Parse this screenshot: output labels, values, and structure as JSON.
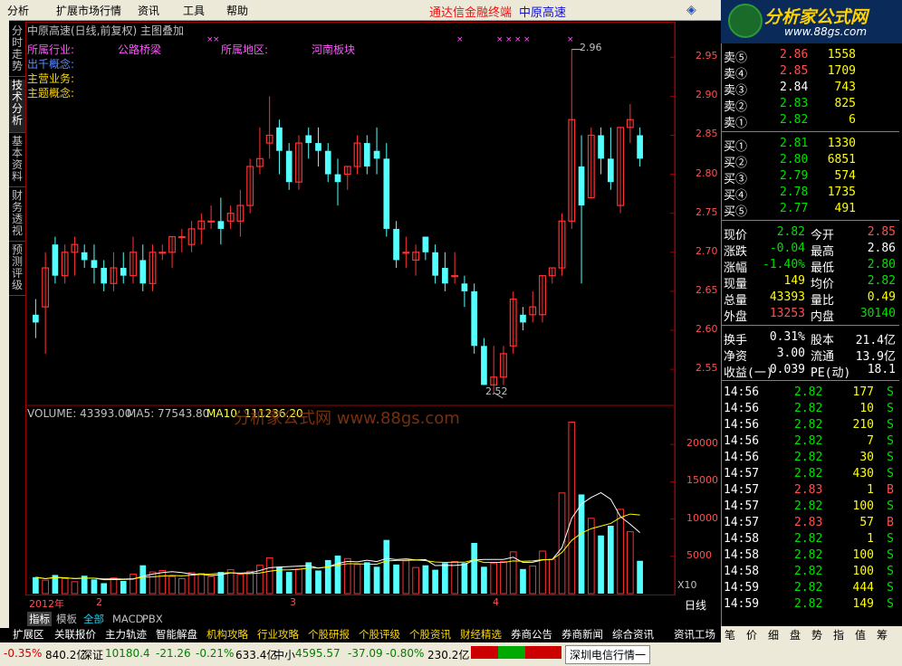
{
  "menu": {
    "items": [
      "分析",
      "扩展市场行情",
      "资讯",
      "工具",
      "帮助"
    ],
    "center_title": "通达信金融终端",
    "stock_name": "中原高速"
  },
  "logo": {
    "brand": "分析家公式网",
    "url": "www.88gs.com"
  },
  "vtabs": [
    "分时走势",
    "技术分析",
    "基本资料",
    "财务透视",
    "预测评级"
  ],
  "chart": {
    "title": "中原高速(日线,前复权) 主图叠加",
    "info": [
      {
        "label": "所属行业:",
        "value": "公路桥梁"
      },
      {
        "label": "所属地区:",
        "value": "河南板块"
      },
      {
        "label": "出千概念:"
      },
      {
        "label": "主营业务:"
      },
      {
        "label": "主题概念:"
      }
    ],
    "high_mark": "2.96",
    "low_mark": "2.52",
    "y_ticks": [
      "2.95",
      "2.90",
      "2.85",
      "2.80",
      "2.75",
      "2.70",
      "2.65",
      "2.60",
      "2.55"
    ],
    "vol_ticks": [
      "20000",
      "15000",
      "10000",
      "5000"
    ],
    "vol_scale": "X10",
    "volume_label": "VOLUME: 43393.00",
    "ma5_label": "MA5: 77543.80",
    "ma10_label": "MA10: 111236.20",
    "watermark": "分析家公式网 www.88gs.com",
    "dates": [
      "2012年",
      "2",
      "3",
      "4"
    ],
    "period": "日线"
  },
  "chart_data": {
    "type": "candlestick",
    "ohlc": [
      [
        2.62,
        2.64,
        2.59,
        2.61
      ],
      [
        2.63,
        2.7,
        2.57,
        2.68
      ],
      [
        2.71,
        2.72,
        2.66,
        2.67
      ],
      [
        2.67,
        2.71,
        2.66,
        2.7
      ],
      [
        2.7,
        2.72,
        2.67,
        2.71
      ],
      [
        2.7,
        2.71,
        2.68,
        2.69
      ],
      [
        2.69,
        2.71,
        2.66,
        2.68
      ],
      [
        2.68,
        2.69,
        2.65,
        2.66
      ],
      [
        2.66,
        2.7,
        2.65,
        2.68
      ],
      [
        2.68,
        2.7,
        2.66,
        2.67
      ],
      [
        2.67,
        2.72,
        2.66,
        2.7
      ],
      [
        2.69,
        2.71,
        2.65,
        2.66
      ],
      [
        2.66,
        2.71,
        2.65,
        2.7
      ],
      [
        2.7,
        2.71,
        2.69,
        2.7
      ],
      [
        2.7,
        2.72,
        2.68,
        2.72
      ],
      [
        2.72,
        2.73,
        2.7,
        2.72
      ],
      [
        2.71,
        2.74,
        2.7,
        2.73
      ],
      [
        2.73,
        2.75,
        2.71,
        2.74
      ],
      [
        2.74,
        2.76,
        2.73,
        2.74
      ],
      [
        2.74,
        2.77,
        2.71,
        2.73
      ],
      [
        2.74,
        2.76,
        2.73,
        2.75
      ],
      [
        2.74,
        2.78,
        2.72,
        2.76
      ],
      [
        2.76,
        2.82,
        2.75,
        2.81
      ],
      [
        2.81,
        2.86,
        2.8,
        2.82
      ],
      [
        2.84,
        2.9,
        2.82,
        2.85
      ],
      [
        2.86,
        2.87,
        2.8,
        2.83
      ],
      [
        2.83,
        2.84,
        2.78,
        2.79
      ],
      [
        2.79,
        2.85,
        2.78,
        2.84
      ],
      [
        2.85,
        2.86,
        2.82,
        2.84
      ],
      [
        2.84,
        2.86,
        2.81,
        2.83
      ],
      [
        2.83,
        2.84,
        2.79,
        2.8
      ],
      [
        2.8,
        2.82,
        2.76,
        2.79
      ],
      [
        2.8,
        2.81,
        2.78,
        2.81
      ],
      [
        2.81,
        2.85,
        2.8,
        2.84
      ],
      [
        2.84,
        2.85,
        2.8,
        2.81
      ],
      [
        2.83,
        2.86,
        2.8,
        2.82
      ],
      [
        2.82,
        2.84,
        2.72,
        2.73
      ],
      [
        2.73,
        2.74,
        2.68,
        2.69
      ],
      [
        2.7,
        2.72,
        2.68,
        2.7
      ],
      [
        2.69,
        2.71,
        2.67,
        2.7
      ],
      [
        2.72,
        2.72,
        2.69,
        2.7
      ],
      [
        2.7,
        2.71,
        2.66,
        2.67
      ],
      [
        2.68,
        2.7,
        2.65,
        2.66
      ],
      [
        2.67,
        2.7,
        2.66,
        2.67
      ],
      [
        2.66,
        2.67,
        2.63,
        2.65
      ],
      [
        2.65,
        2.66,
        2.57,
        2.58
      ],
      [
        2.58,
        2.59,
        2.53,
        2.53
      ],
      [
        2.53,
        2.58,
        2.52,
        2.54
      ],
      [
        2.54,
        2.58,
        2.53,
        2.57
      ],
      [
        2.58,
        2.65,
        2.57,
        2.64
      ],
      [
        2.62,
        2.63,
        2.6,
        2.61
      ],
      [
        2.62,
        2.65,
        2.61,
        2.63
      ],
      [
        2.62,
        2.67,
        2.61,
        2.67
      ],
      [
        2.67,
        2.68,
        2.66,
        2.68
      ],
      [
        2.68,
        2.75,
        2.67,
        2.74
      ],
      [
        2.74,
        2.96,
        2.73,
        2.87
      ],
      [
        2.81,
        2.85,
        2.66,
        2.76
      ],
      [
        2.77,
        2.86,
        2.77,
        2.85
      ],
      [
        2.85,
        2.86,
        2.8,
        2.82
      ],
      [
        2.82,
        2.86,
        2.78,
        2.79
      ],
      [
        2.76,
        2.86,
        2.75,
        2.86
      ],
      [
        2.86,
        2.89,
        2.84,
        2.87
      ],
      [
        2.85,
        2.86,
        2.81,
        2.82
      ]
    ],
    "volume": [
      2200,
      1800,
      2500,
      2000,
      1600,
      2400,
      1900,
      1400,
      2100,
      1700,
      2600,
      3800,
      2900,
      3100,
      2300,
      2000,
      2800,
      2700,
      2300,
      2900,
      3200,
      2600,
      3000,
      3800,
      4800,
      3600,
      2900,
      3300,
      4200,
      3100,
      4500,
      5100,
      4700,
      3900,
      4200,
      3600,
      7200,
      3900,
      4400,
      3500,
      3800,
      3200,
      4100,
      4300,
      4100,
      6800,
      3600,
      4100,
      4300,
      5600,
      3300,
      3700,
      5700,
      4600,
      13500,
      23000,
      13300,
      10100,
      7800,
      9100,
      11300,
      8300,
      4400
    ],
    "ylim": [
      2.52,
      2.97
    ]
  },
  "quote": {
    "sell": [
      [
        "卖⑤",
        "2.86",
        "1558"
      ],
      [
        "卖④",
        "2.85",
        "1709"
      ],
      [
        "卖③",
        "2.84",
        "743"
      ],
      [
        "卖②",
        "2.83",
        "825"
      ],
      [
        "卖①",
        "2.82",
        "6"
      ]
    ],
    "buy": [
      [
        "买①",
        "2.81",
        "1330"
      ],
      [
        "买②",
        "2.80",
        "6851"
      ],
      [
        "买③",
        "2.79",
        "574"
      ],
      [
        "买④",
        "2.78",
        "1735"
      ],
      [
        "买⑤",
        "2.77",
        "491"
      ]
    ],
    "stats": [
      [
        "现价",
        "2.82",
        "今开",
        "2.85"
      ],
      [
        "涨跌",
        "-0.04",
        "最高",
        "2.86"
      ],
      [
        "涨幅",
        "-1.40%",
        "最低",
        "2.80"
      ],
      [
        "现量",
        "149",
        "均价",
        "2.82"
      ],
      [
        "总量",
        "43393",
        "量比",
        "0.49"
      ],
      [
        "外盘",
        "13253",
        "内盘",
        "30140"
      ]
    ],
    "stats2": [
      [
        "换手",
        "0.31%",
        "股本",
        "21.4亿"
      ],
      [
        "净资",
        "3.00",
        "流通",
        "13.9亿"
      ],
      [
        "收益(一)",
        "0.039",
        "PE(动)",
        "18.1"
      ]
    ],
    "ticks": [
      [
        "14:56",
        "2.82",
        "177",
        "S"
      ],
      [
        "14:56",
        "2.82",
        "10",
        "S"
      ],
      [
        "14:56",
        "2.82",
        "210",
        "S"
      ],
      [
        "14:56",
        "2.82",
        "7",
        "S"
      ],
      [
        "14:56",
        "2.82",
        "30",
        "S"
      ],
      [
        "14:57",
        "2.82",
        "430",
        "S"
      ],
      [
        "14:57",
        "2.83",
        "1",
        "B"
      ],
      [
        "14:57",
        "2.82",
        "100",
        "S"
      ],
      [
        "14:57",
        "2.83",
        "57",
        "B"
      ],
      [
        "14:58",
        "2.82",
        "1",
        "S"
      ],
      [
        "14:58",
        "2.82",
        "100",
        "S"
      ],
      [
        "14:58",
        "2.82",
        "100",
        "S"
      ],
      [
        "14:59",
        "2.82",
        "444",
        "S"
      ],
      [
        "14:59",
        "2.82",
        "149",
        "S"
      ]
    ]
  },
  "bottomtabs": [
    "指标",
    "模板",
    "全部",
    "MACD",
    "PBX",
    "扩展区",
    "关联报价",
    "主力轨迹",
    "智能解盘",
    "机构攻略",
    "行业攻略",
    "个股研报",
    "个股评级",
    "个股资讯",
    "财经精选",
    "券商公告",
    "券商新闻",
    "综合资讯",
    "资讯工场"
  ],
  "righttabs": [
    "笔",
    "价",
    "细",
    "盘",
    "势",
    "指",
    "值",
    "筹"
  ],
  "status": {
    "sh_pct": "-0.35%",
    "sh_amt": "840.2亿",
    "sz_name": "深证",
    "sz_val": "10180.4",
    "sz_chg": "-21.26",
    "sz_pct": "-0.21%",
    "sz_amt": "633.4亿",
    "zx_name": "中小",
    "zx_val": "4595.57",
    "zx_chg": "-37.09",
    "zx_pct": "-0.80%",
    "zx_amt": "230.2亿",
    "server": "深圳电信行情一"
  },
  "colors": {
    "up": "#ff3232",
    "down": "#54ffff",
    "ma5": "#ffffff",
    "ma10": "#ffff00"
  }
}
